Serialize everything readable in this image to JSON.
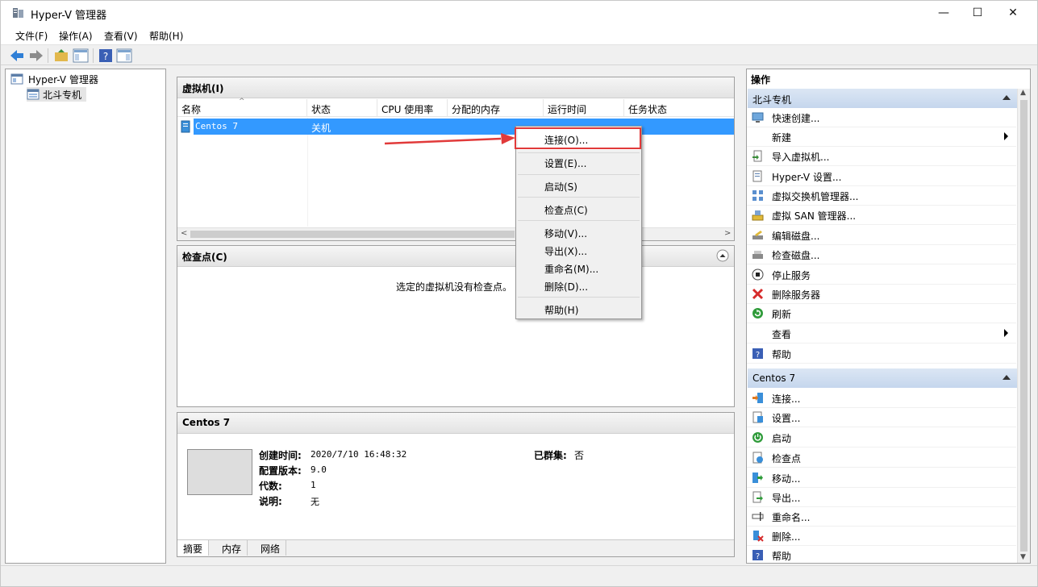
{
  "window": {
    "title": "Hyper-V 管理器",
    "controls": {
      "minimize": "—",
      "maximize": "☐",
      "close": "✕"
    }
  },
  "menu": [
    "文件(F)",
    "操作(A)",
    "查看(V)",
    "帮助(H)"
  ],
  "tree": {
    "root": "Hyper-V 管理器",
    "server": "北斗专机"
  },
  "vms_pane": {
    "title": "虚拟机(I)",
    "columns": [
      "名称",
      "状态",
      "CPU 使用率",
      "分配的内存",
      "运行时间",
      "任务状态"
    ],
    "rows": [
      {
        "name": "Centos 7",
        "state": "关机"
      }
    ]
  },
  "checkpoints_pane": {
    "title": "检查点(C)",
    "empty_text": "选定的虚拟机没有检查点。"
  },
  "details_pane": {
    "title": "Centos 7",
    "fields": [
      {
        "label": "创建时间:",
        "value": "2020/7/10 16:48:32"
      },
      {
        "label": "配置版本:",
        "value": "9.0"
      },
      {
        "label": "代数:",
        "value": "1"
      },
      {
        "label": "说明:",
        "value": "无"
      }
    ],
    "clustered_label": "已群集:",
    "clustered_value": "否",
    "tabs": [
      "摘要",
      "内存",
      "网络"
    ]
  },
  "context_menu": {
    "items": [
      "连接(O)...",
      "设置(E)...",
      "启动(S)",
      "检查点(C)",
      "移动(V)...",
      "导出(X)...",
      "重命名(M)...",
      "删除(D)...",
      "帮助(H)"
    ]
  },
  "actions": {
    "title": "操作",
    "server_group": "北斗专机",
    "server_items": [
      "快速创建...",
      "新建",
      "导入虚拟机...",
      "Hyper-V 设置...",
      "虚拟交换机管理器...",
      "虚拟 SAN 管理器...",
      "编辑磁盘...",
      "检查磁盘...",
      "停止服务",
      "删除服务器",
      "刷新",
      "查看",
      "帮助"
    ],
    "vm_group": "Centos 7",
    "vm_items": [
      "连接...",
      "设置...",
      "启动",
      "检查点",
      "移动...",
      "导出...",
      "重命名...",
      "删除...",
      "帮助"
    ]
  },
  "colors": {
    "selection": "#3399ff",
    "highlight": "#e13a3a",
    "group_header": "#c9d9ee"
  }
}
